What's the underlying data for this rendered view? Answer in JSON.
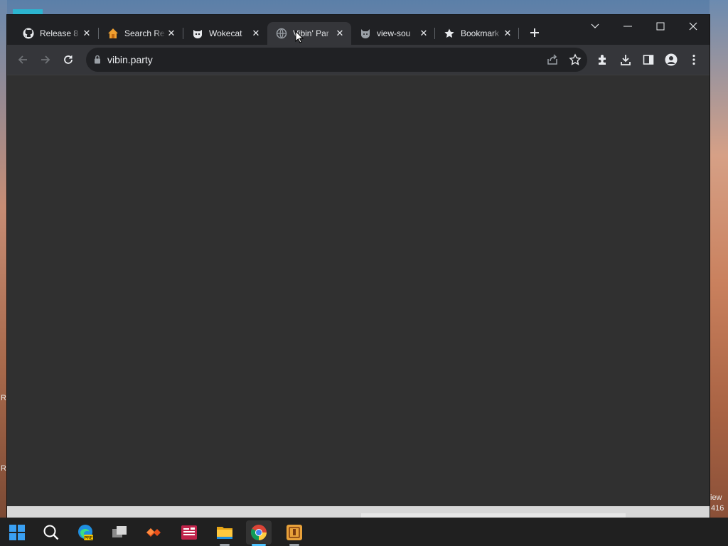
{
  "browser": {
    "tabs": [
      {
        "title": "Release 8",
        "icon": "github-icon",
        "active": false
      },
      {
        "title": "Search Re",
        "icon": "house-icon",
        "active": false
      },
      {
        "title": "Wokecat",
        "icon": "wokecat-icon",
        "active": false
      },
      {
        "title": "Vibin' Par",
        "icon": "globe-icon",
        "active": true
      },
      {
        "title": "view-sou",
        "icon": "cat-icon",
        "active": false
      },
      {
        "title": "Bookmark",
        "icon": "star-icon",
        "active": false
      }
    ],
    "address": {
      "url": "vibin.party"
    }
  },
  "desktop": {
    "corner_text_line1": "iew",
    "corner_text_line2": "416",
    "left_edge_text_1": "R",
    "left_edge_text_2": "R"
  },
  "taskbar": {
    "items": [
      "start-icon",
      "search-icon",
      "edge-preview-icon",
      "task-view-icon",
      "app-orange-icon",
      "app-red-icon",
      "file-explorer-icon",
      "chrome-icon",
      "app-gold-icon"
    ],
    "active_item": "chrome-icon"
  },
  "colors": {
    "accent": "#4cc2ff",
    "tab_active": "#35363a",
    "frame": "#202124",
    "content": "#303030"
  }
}
